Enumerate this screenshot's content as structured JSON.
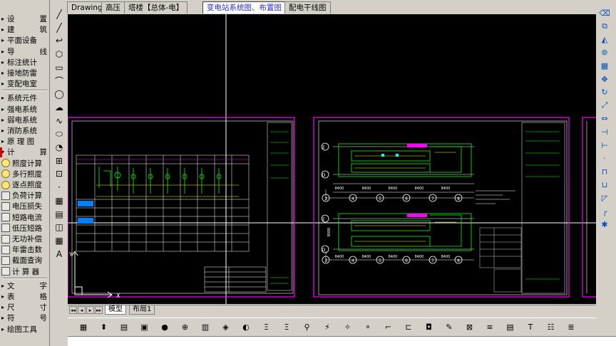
{
  "left_menu": {
    "items": [
      {
        "label_a": "设",
        "label_b": "置",
        "arrow": "▸",
        "icon": ""
      },
      {
        "label_a": "建",
        "label_b": "筑",
        "arrow": "▸",
        "icon": ""
      },
      {
        "label_a": "平面设备",
        "label_b": "",
        "arrow": "▸",
        "icon": ""
      },
      {
        "label_a": "导",
        "label_b": "线",
        "arrow": "▸",
        "icon": ""
      },
      {
        "label_a": "标注统计",
        "label_b": "",
        "arrow": "▸",
        "icon": ""
      },
      {
        "label_a": "接地防雷",
        "label_b": "",
        "arrow": "▸",
        "icon": ""
      },
      {
        "label_a": "变配电室",
        "label_b": "",
        "arrow": "▸",
        "icon": ""
      },
      {
        "label_a": "系统元件",
        "label_b": "",
        "arrow": "▸",
        "icon": ""
      },
      {
        "label_a": "强电系统",
        "label_b": "",
        "arrow": "▸",
        "icon": ""
      },
      {
        "label_a": "弱电系统",
        "label_b": "",
        "arrow": "▸",
        "icon": ""
      },
      {
        "label_a": "消防系统",
        "label_b": "",
        "arrow": "▸",
        "icon": ""
      },
      {
        "label_a": "原 理 图",
        "label_b": "",
        "arrow": "▸",
        "icon": ""
      },
      {
        "label_a": "计",
        "label_b": "算",
        "arrow": "▾",
        "icon": ""
      },
      {
        "label_a": "照度计算",
        "label_b": "",
        "arrow": "",
        "icon": "bulb"
      },
      {
        "label_a": "多行照度",
        "label_b": "",
        "arrow": "",
        "icon": "bulb"
      },
      {
        "label_a": "逐点照度",
        "label_b": "",
        "arrow": "",
        "icon": "bulb"
      },
      {
        "label_a": "负荷计算",
        "label_b": "",
        "arrow": "",
        "icon": "box"
      },
      {
        "label_a": "电压损失",
        "label_b": "",
        "arrow": "",
        "icon": "box"
      },
      {
        "label_a": "短路电流",
        "label_b": "",
        "arrow": "",
        "icon": "box"
      },
      {
        "label_a": "低压短路",
        "label_b": "",
        "arrow": "",
        "icon": "box"
      },
      {
        "label_a": "无功补偿",
        "label_b": "",
        "arrow": "",
        "icon": "box"
      },
      {
        "label_a": "年雷击数",
        "label_b": "",
        "arrow": "",
        "icon": "box"
      },
      {
        "label_a": "截面查询",
        "label_b": "",
        "arrow": "",
        "icon": "box"
      },
      {
        "label_a": "计 算 器",
        "label_b": "",
        "arrow": "",
        "icon": "box"
      },
      {
        "label_a": "文",
        "label_b": "字",
        "arrow": "▸",
        "icon": ""
      },
      {
        "label_a": "表",
        "label_b": "格",
        "arrow": "▸",
        "icon": ""
      },
      {
        "label_a": "尺",
        "label_b": "寸",
        "arrow": "▸",
        "icon": ""
      },
      {
        "label_a": "符",
        "label_b": "号",
        "arrow": "▸",
        "icon": ""
      },
      {
        "label_a": "绘图工具",
        "label_b": "",
        "arrow": "▸",
        "icon": ""
      }
    ]
  },
  "tabs": [
    {
      "label": "Drawing1",
      "active": false
    },
    {
      "label": "高压",
      "active": false
    },
    {
      "label": "塔楼【总体-电】",
      "active": false
    },
    {
      "label": "变电站系统图、布置图",
      "active": true
    },
    {
      "label": "配电干线图",
      "active": false
    }
  ],
  "layout_tabs": [
    {
      "label": "模型",
      "active": true
    },
    {
      "label": "布局1",
      "active": false
    }
  ],
  "layout_nav": [
    "◂◂",
    "◂",
    "▸",
    "▸▸"
  ],
  "canvas": {
    "background": "#000000",
    "frame_color": "#ff00ff",
    "line_color": "#ffffff",
    "accent_green": "#00ff00",
    "accent_yellow": "#ffff00",
    "axis_labels_top": [
      "E",
      "D"
    ],
    "axis_labels_bottom": [
      "E",
      "D"
    ],
    "grid_numbers_top": [
      "3",
      "4",
      "5",
      "6",
      "7",
      "8"
    ],
    "grid_numbers_bottom": [
      "3",
      "4",
      "5",
      "6",
      "7",
      "8"
    ],
    "dims_top": [
      "8400",
      "8400",
      "8400",
      "8400",
      "8400"
    ],
    "dims_bottom": [
      "8400",
      "8400",
      "8400",
      "8400",
      "8400"
    ],
    "left_dim": "8000",
    "ucs_labels": [
      "Y",
      "X"
    ]
  },
  "draw_tools": [
    "line-tool-icon",
    "xline-tool-icon",
    "polyline-tool-icon",
    "polygon-tool-icon",
    "rectangle-tool-icon",
    "arc-tool-icon",
    "circle-tool-icon",
    "revcloud-tool-icon",
    "spline-tool-icon",
    "ellipse-tool-icon",
    "ellipse-arc-tool-icon",
    "insert-block-icon",
    "make-block-icon",
    "point-tool-icon",
    "hatch-tool-icon",
    "gradient-tool-icon",
    "region-tool-icon",
    "table-tool-icon",
    "mtext-tool-icon"
  ],
  "draw_glyphs": [
    "╱",
    "╱",
    "↩",
    "⬡",
    "▭",
    "⌒",
    "◯",
    "☁",
    "∿",
    "⬭",
    "◔",
    "⊞",
    "⊡",
    "·",
    "▦",
    "▤",
    "◫",
    "▦",
    "A"
  ],
  "right_tools": [
    "erase-icon",
    "copy-icon",
    "mirror-icon",
    "offset-icon",
    "array-icon",
    "move-icon",
    "rotate-icon",
    "scale-icon",
    "stretch-icon",
    "trim-icon",
    "extend-icon",
    "break-point-icon",
    "break-icon",
    "join-icon",
    "chamfer-icon",
    "fillet-icon",
    "explode-icon"
  ],
  "right_glyphs": [
    "⌫",
    "⧉",
    "◭",
    "⊚",
    "▦",
    "✥",
    "↻",
    "⤢",
    "⇔",
    "⊣",
    "⊢",
    "·",
    "⊓",
    "⊔",
    "◸",
    "╭",
    "✱"
  ],
  "bottom_tools": [
    "zoom-icon",
    "open-icon",
    "print-icon",
    "save-icon",
    "layer-icon",
    "match-icon",
    "block-icon",
    "attribute-icon",
    "insert-icon",
    "dimension-icon",
    "symbol-icon",
    "wire-icon",
    "device-icon",
    "lightning-icon",
    "search-icon",
    "edit-icon",
    "select-icon",
    "property-icon",
    "measure-icon",
    "table-icon",
    "tag-icon",
    "calc-icon",
    "report-icon",
    "purge-icon",
    "help-icon"
  ],
  "bottom_glyphs": [
    "▦",
    "⬍",
    "▤",
    "▣",
    "●",
    "⊕",
    "▥",
    "◈",
    "◐",
    "Ξ",
    "Ξ",
    "⚲",
    "⚡",
    "✧",
    "⚬",
    "⌐",
    "⊏",
    "◘",
    "✎",
    "⊠",
    "≡",
    "▤",
    "T",
    "☷",
    "≣"
  ]
}
